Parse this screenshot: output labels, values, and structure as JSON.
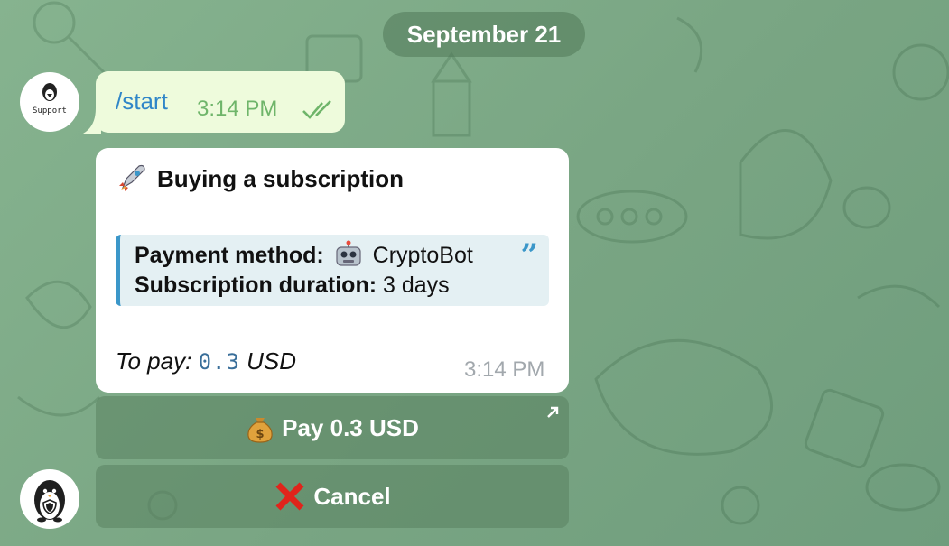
{
  "date_separator": "September 21",
  "support_avatar": {
    "label": "Support"
  },
  "outgoing": {
    "text": "/start",
    "time": "3:14 PM"
  },
  "incoming": {
    "title": "Buying a subscription",
    "quote": {
      "method_label": "Payment method:",
      "method_value": "CryptoBot",
      "duration_label": "Subscription duration:",
      "duration_value": "3 days"
    },
    "pay_label": "To pay:",
    "pay_amount": "0.3",
    "pay_currency": "USD",
    "time": "3:14 PM"
  },
  "keyboard": {
    "pay_label": "Pay 0.3 USD",
    "cancel_label": "Cancel"
  },
  "colors": {
    "accent": "#3b97c9",
    "tick": "#6fb56a",
    "bubble_out": "#eefbdc"
  }
}
